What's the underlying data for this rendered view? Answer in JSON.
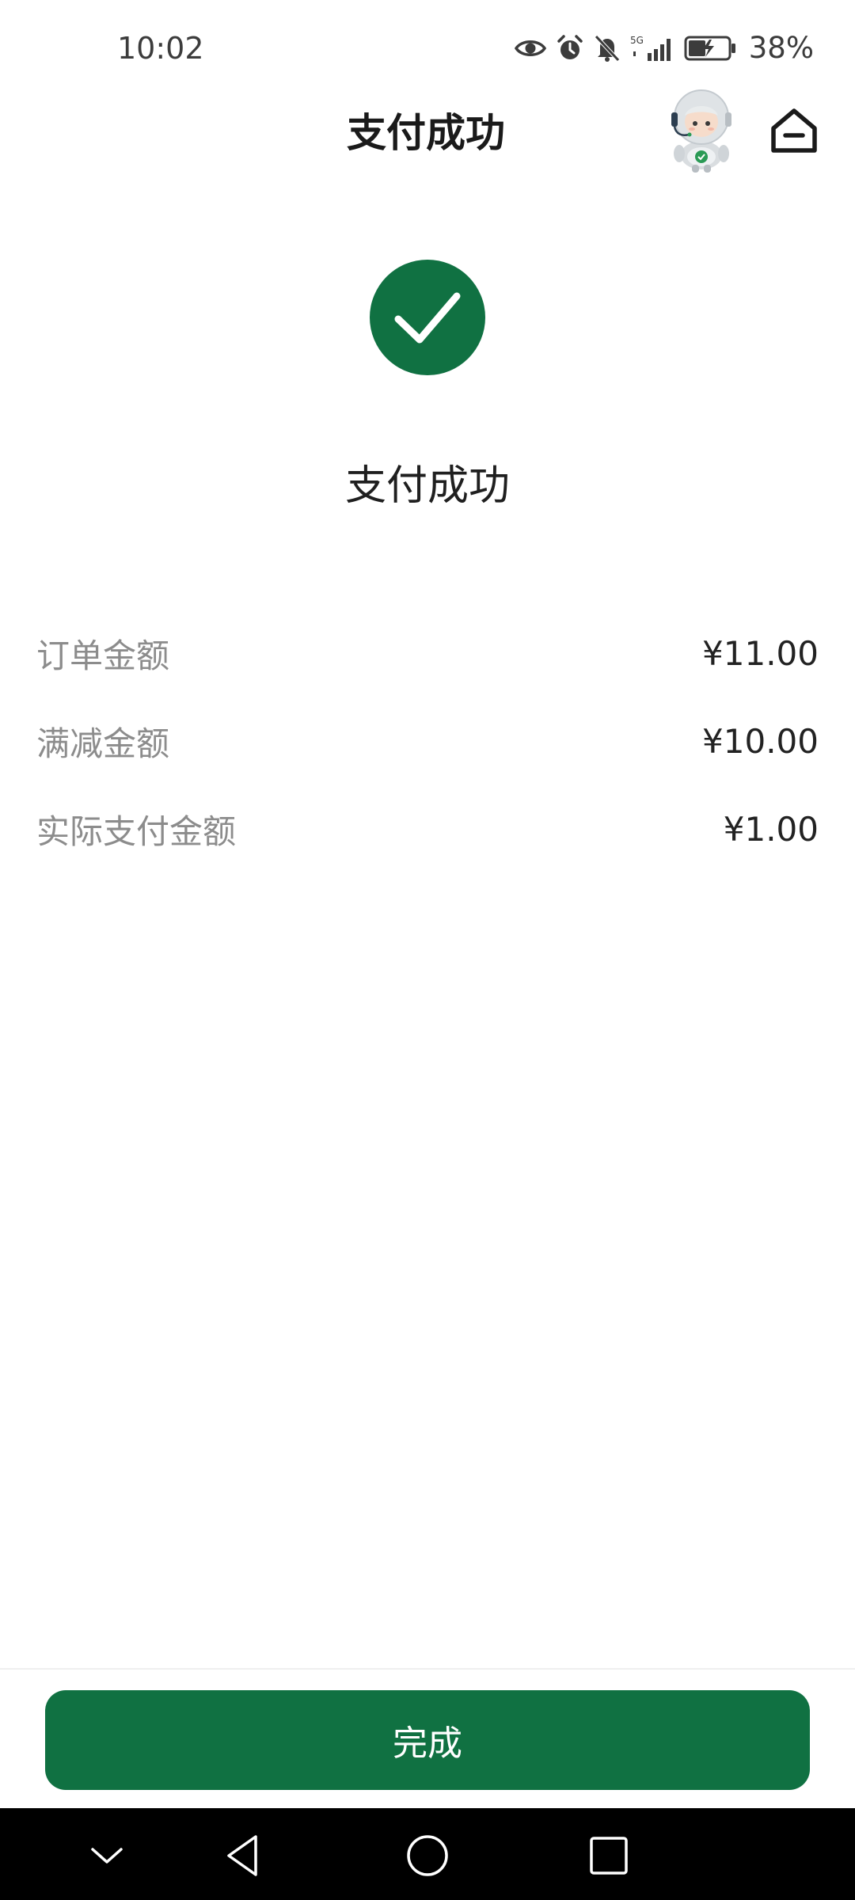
{
  "status_bar": {
    "time": "10:02",
    "network_label": "5G",
    "battery_percent": "38%",
    "icons": [
      "eye-icon",
      "alarm-icon",
      "mute-bell-icon",
      "signal-icon",
      "battery-charging-icon"
    ]
  },
  "header": {
    "title": "支付成功",
    "avatar_icon": "robot-assistant-icon",
    "home_icon": "home-icon"
  },
  "result": {
    "status_icon": "check-circle-icon",
    "status_text": "支付成功"
  },
  "details": [
    {
      "label": "订单金额",
      "value": "¥11.00"
    },
    {
      "label": "满减金额",
      "value": "¥10.00"
    },
    {
      "label": "实际支付金额",
      "value": "¥1.00"
    }
  ],
  "actions": {
    "done_label": "完成"
  },
  "nav_bar": {
    "buttons": [
      "collapse-icon",
      "back-icon",
      "home-circle-icon",
      "recents-icon"
    ]
  },
  "colors": {
    "accent": "#107142",
    "title_text": "#1a1a1a",
    "label_text": "#8c8c8c",
    "value_text": "#222222"
  }
}
